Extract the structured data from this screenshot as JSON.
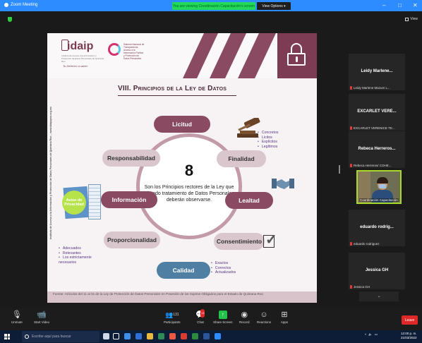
{
  "window": {
    "app_title": "Zoom Meeting",
    "viewing_banner": "You are viewing Coordinación Capacitación's screen",
    "view_options": "View Options ▾",
    "view_button": "View",
    "controls": [
      "–",
      "□",
      "✕"
    ]
  },
  "slide": {
    "logo_daip": "idaip",
    "logo_daip_sub": "Instituto de Acceso a la Información y Protección de Datos Personales de Quintana Roo",
    "logo_daip_sign": "Tu Derecho a saber",
    "logo_snt": "Sistema Nacional de Transparencia, Acceso a la Información Pública y Protección de Datos Personales",
    "side_text": "Instituto de Acceso a la Información y Protección de Datos Personales de Quintana Roo – www.idaipqroo.org.mx",
    "title": "VIII. Principios de la Ley de Datos",
    "center_number": "8",
    "center_text": "Son los Principios rectores de la Ley que en todo tratamiento de Datos Personales deberán observarse.",
    "principles": {
      "licitud": "Licitud",
      "responsabilidad": "Responsabilidad",
      "finalidad": "Finalidad",
      "informacion": "Información",
      "lealtad": "Lealtad",
      "proporcionalidad": "Proporcionalidad",
      "consentimiento": "Consentimiento",
      "calidad": "Calidad"
    },
    "finalidad_bullets": [
      "Concretos",
      "Lícitos",
      "Explícitos",
      "Legítimos"
    ],
    "proporcionalidad_bullets": [
      "Adecuados",
      "Relevantes",
      "Los estrictamente necesarios"
    ],
    "calidad_bullets": [
      "Exactos",
      "Correctos",
      "Actualizados"
    ],
    "aviso_label": "Aviso de Privacidad",
    "footer": "Fuente: Artículos del 11 al 31 de la Ley de Protección de Datos Personales en Posesión de los Sujetos Obligados para el Estado de Quintana Roo",
    "colors": {
      "accent": "#7e3b54",
      "pill_light": "#d9c7cd",
      "pill_dark": "#8a4a62",
      "pill_blue": "#4f7fa2",
      "bullet": "#5a3785"
    }
  },
  "participants": [
    {
      "name": "Leidy Marlene...",
      "label": "Leidy Marlene Mazum L..."
    },
    {
      "name": "EXCARLET VERE...",
      "label": "EXCARLET VERENICE TE..."
    },
    {
      "name": "Rebeca Herreros...",
      "label": "Rebeca Herreros/ COHE..."
    },
    {
      "name": "eduardo rodrig...",
      "label": "eduardo rodriguez"
    },
    {
      "name": "Jessica GH",
      "label": "Jessica GH"
    }
  ],
  "active_speaker": {
    "label": "Coordinación Capacitación"
  },
  "scroll_down": "⌄",
  "toolbar": {
    "unmute": "Unmute",
    "start_video": "Start Video",
    "participants": "Participants",
    "participants_count": "131",
    "chat": "Chat",
    "chat_badge": "13",
    "share_screen": "Share Screen",
    "record": "Record",
    "reactions": "Reactions",
    "apps": "Apps",
    "leave": "Leave"
  },
  "taskbar": {
    "search_placeholder": "Escribe aquí para buscar",
    "time": "12:00 p. m.",
    "date": "21/03/2022"
  }
}
